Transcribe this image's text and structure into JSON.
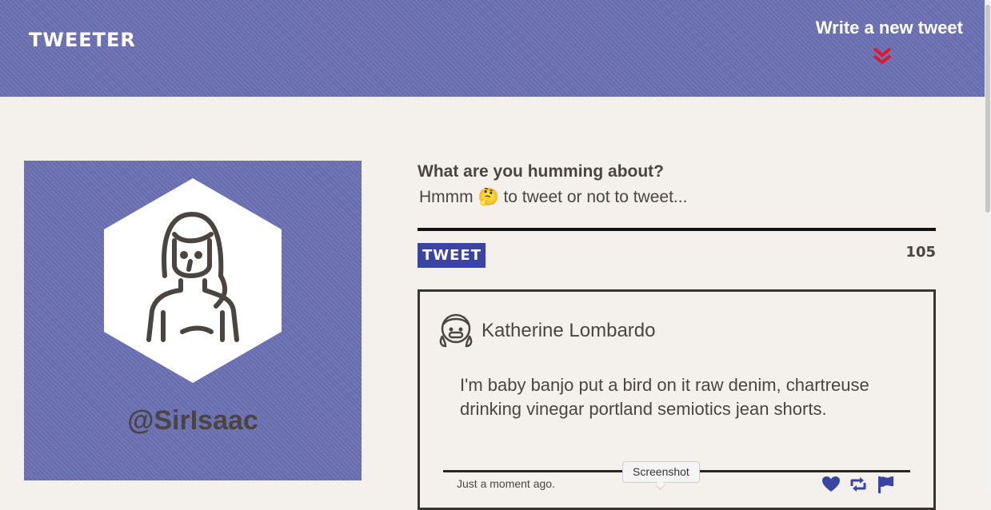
{
  "nav": {
    "brand": "TWEETER",
    "compose_toggle": "Write a new tweet",
    "toggle_icon": "double-chevron-down-icon",
    "toggle_color": "#e0192a"
  },
  "profile": {
    "handle": "@SirIsaac",
    "avatar_icon": "user-avatar-icon"
  },
  "composer": {
    "label": "What are you humming about?",
    "value": "Hmmm 🤔 to tweet or not to tweet...",
    "button_label": "TWEET",
    "char_counter": "105"
  },
  "tweets": [
    {
      "author": "Katherine Lombardo",
      "body": "I'm baby banjo put a bird on it raw denim, chartreuse drinking vinegar portland semiotics jean shorts.",
      "timestamp": "Just a moment ago.",
      "actions": [
        "heart-icon",
        "retweet-icon",
        "flag-icon"
      ]
    }
  ],
  "tooltip": "Screenshot",
  "colors": {
    "brand": "#6b70b4",
    "button": "#3b44a3",
    "background": "#f4f1ec",
    "text": "#4a4540"
  }
}
